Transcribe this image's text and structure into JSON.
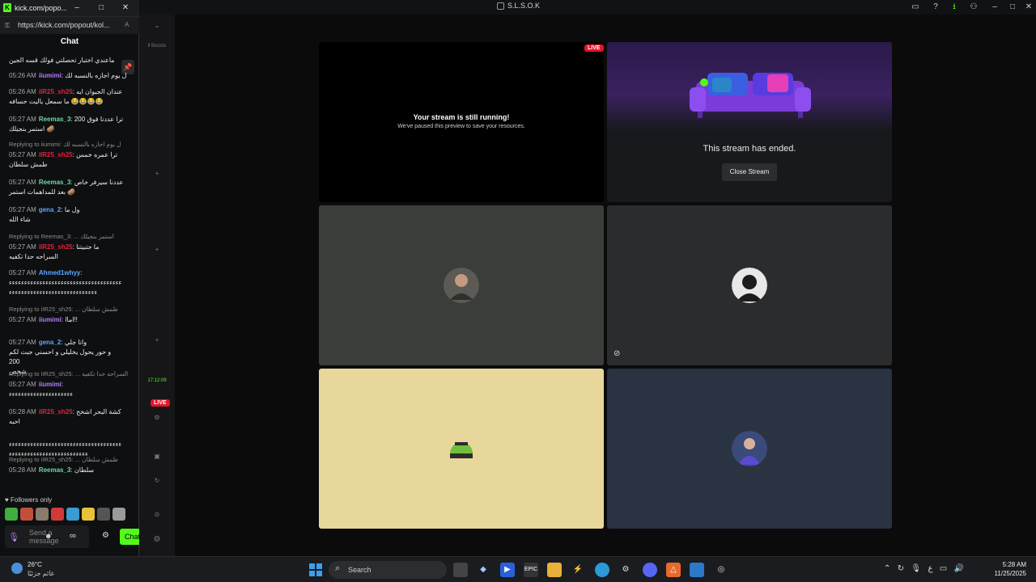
{
  "app": {
    "title": "S.L.S.O.K",
    "rail": {
      "boosts": "ll Boosts",
      "time": "17:12:09"
    }
  },
  "tiles": {
    "running": {
      "badge": "LIVE",
      "title": "Your stream is still running!",
      "subtitle": "We've paused this preview to save your resources."
    },
    "ended": {
      "text": "This stream has ended.",
      "button": "Close Stream"
    }
  },
  "popout": {
    "window_title": "kick.com/popo...",
    "url": "https://kick.com/popout/kol...",
    "chat_title": "Chat",
    "followers_only": "Followers only",
    "input_placeholder": "Send a message",
    "chat_button": "Chat"
  },
  "chat": [
    {
      "text": "ماعندي اختبار تحصلتي فولك قسه الجين"
    },
    {
      "time": "05:26 AM",
      "user": "iiumimi",
      "color": "purple",
      "text": "ل يوم اجازه بالنسبه لك"
    },
    {
      "time": "05:26 AM",
      "user": "iIR25_sh25",
      "color": "red",
      "text": "عندان الجيوان ايه",
      "line2": "ما سمعل ياليت حسافه 😂😂😂😂"
    },
    {
      "time": "05:27 AM",
      "user": "Reemas_3",
      "color": "green",
      "text": "ترا عددنا فوق 200",
      "line2": "استمر بنجيلك 🥔"
    },
    {
      "reply": "Replying to iiumimi: ل يوم اجازه بالنسبه لك"
    },
    {
      "time": "05:27 AM",
      "user": "iIR25_sh25",
      "color": "red",
      "text": "ترا عمره خمس",
      "line2": "طمش سلطان"
    },
    {
      "time": "05:27 AM",
      "user": "Reemas_3",
      "color": "green",
      "text": "عددنا سيرفر خاص",
      "line2": "بعد للمداهمات استمر 🥔"
    },
    {
      "time": "05:27 AM",
      "user": "gena_2",
      "color": "blue",
      "text": "ول ما",
      "line2": "شاء الله"
    },
    {
      "reply": "Replying to Reemas_3: ... استمر بنجيلك"
    },
    {
      "time": "05:27 AM",
      "user": "iIR25_sh25",
      "color": "red",
      "text": "ما جتبيتنا",
      "line2": "السراحه حدا تكفيه"
    },
    {
      "time": "05:27 AM",
      "user": "Ahmed1whyy",
      "color": "blue",
      "text": "",
      "line2": "ءءءءءءءءءءءءءءءءءءءءءءءءءءءءءءءءءءءءء",
      "line3": "ءءءءءءءءءءءءءءءءءءءءءءءءءءءءء"
    },
    {
      "reply": "Replying to iIR25_sh25: ... طمش سلطان"
    },
    {
      "time": "05:27 AM",
      "user": "iiumimi",
      "color": "purple",
      "text": "اماا!!"
    },
    {
      "time": "05:27 AM",
      "user": "gena_2",
      "color": "blue",
      "text": "واتا جلي",
      "line2": "و حور يحول يخليلي و احسني جبت لكم",
      "line3": "200",
      "line4": "شخص"
    },
    {
      "reply": "Replying to iIR25_sh25: ... السراحه حدا تكفيه"
    },
    {
      "time": "05:27 AM",
      "user": "iiumimi",
      "color": "purple",
      "text": "",
      "line2": "ءءءءءءءءءءءءءءءءءءءءء"
    },
    {
      "time": "05:28 AM",
      "user": "iIR25_sh25",
      "color": "red",
      "text": "كشة البحر اشخح",
      "line2": "احبه"
    },
    {
      "line2": "ءءءءءءءءءءءءءءءءءءءءءءءءءءءءءءءءءءءءء",
      "line3": "ءءءءءءءءءءءءءءءءءءءءءءءءءء"
    },
    {
      "reply": "Replying to iIR25_sh25: ... طمش سلطان"
    },
    {
      "time": "05:28 AM",
      "user": "Reemas_3",
      "color": "green",
      "text": "سلطان"
    }
  ],
  "taskbar": {
    "weather_temp": "26°C",
    "weather_desc": "غائم جزئيًا",
    "search": "Search",
    "time": "5:28 AM",
    "date": "11/25/2025",
    "lang": "ع"
  }
}
